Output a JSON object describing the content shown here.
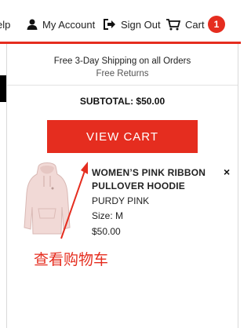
{
  "nav": {
    "help_fragment": "elp",
    "account_label": "My Account",
    "signout_label": "Sign Out",
    "cart_label": "Cart",
    "cart_count": "1"
  },
  "cart_panel": {
    "shipping_text": "Free 3-Day Shipping on all Orders",
    "returns_text": "Free Returns",
    "subtotal_text": "SUBTOTAL: $50.00",
    "view_cart_label": "VIEW CART",
    "item": {
      "name": "WOMEN’S PINK RIBBON PULLOVER HOODIE",
      "color": "PURDY PINK",
      "size": "Size: M",
      "price": "$50.00",
      "remove_label": "×"
    }
  },
  "annotation": {
    "text": "查看购物车"
  },
  "colors": {
    "accent": "#e52d1f",
    "product": "#f1d9d6"
  },
  "icons": [
    "user-icon",
    "sign-out-icon",
    "cart-icon",
    "close-icon",
    "hoodie-image"
  ]
}
